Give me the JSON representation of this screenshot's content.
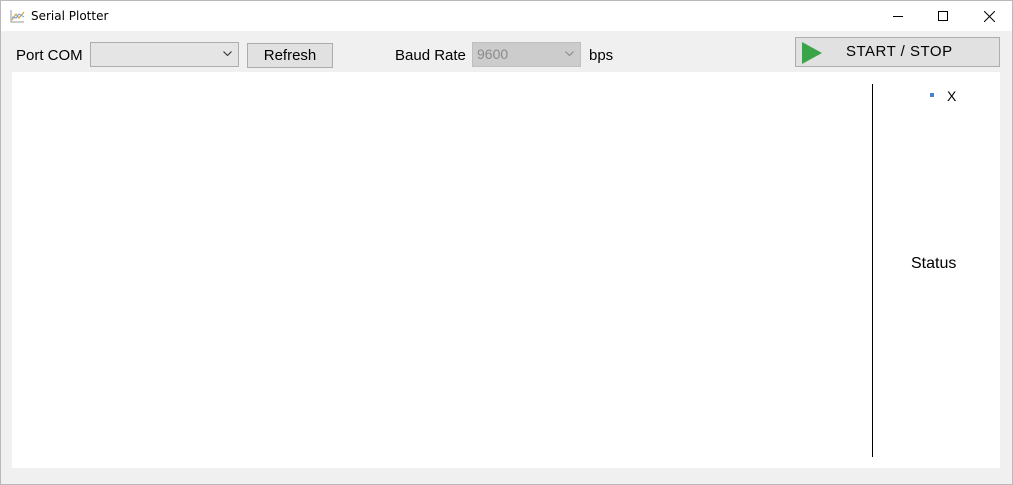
{
  "window": {
    "title": "Serial Plotter"
  },
  "toolbar": {
    "port_label": "Port COM",
    "port_value": "",
    "refresh_label": "Refresh",
    "baud_label": "Baud Rate",
    "baud_value": "9600",
    "bps_label": "bps",
    "start_stop_label": "START / STOP",
    "play_icon_color": "#3aa548"
  },
  "plot": {
    "legend": [
      {
        "name": "X",
        "color": "#4a7fd6"
      }
    ],
    "status_label": "Status"
  },
  "icons": {
    "app": "chart-line-icon",
    "minimize": "minimize-icon",
    "maximize": "maximize-icon",
    "close": "close-icon",
    "dropdown": "chevron-down-icon",
    "start": "play-icon"
  }
}
